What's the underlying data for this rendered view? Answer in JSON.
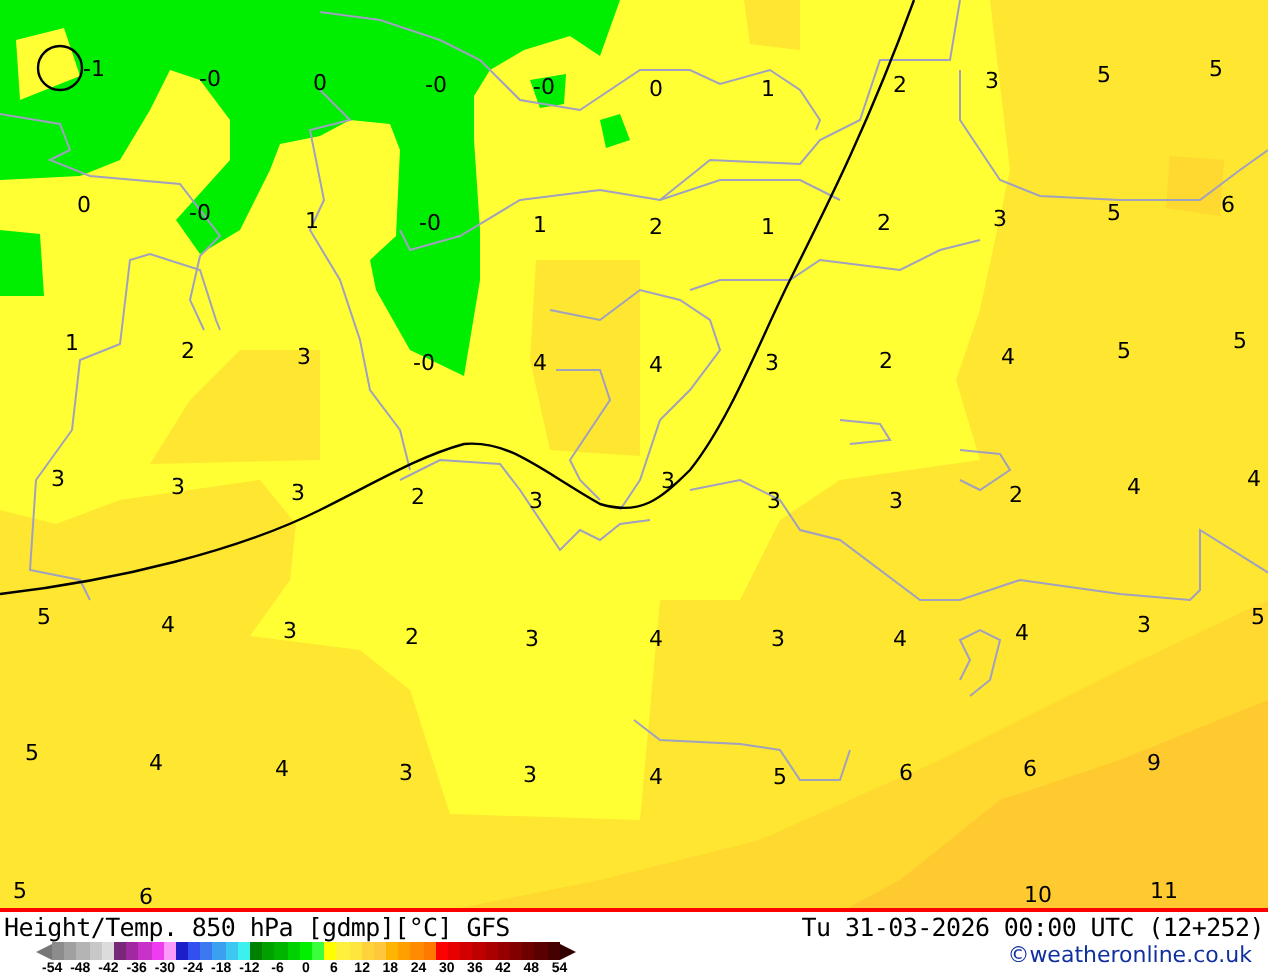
{
  "map": {
    "labels": [
      {
        "text": "-1"
      },
      {
        "text": "-0"
      },
      {
        "text": "0"
      },
      {
        "text": "-0"
      },
      {
        "text": "-0"
      },
      {
        "text": "0"
      },
      {
        "text": "1"
      },
      {
        "text": "2"
      },
      {
        "text": "3"
      },
      {
        "text": "5"
      },
      {
        "text": "5"
      },
      {
        "text": "0"
      },
      {
        "text": "-0"
      },
      {
        "text": "1"
      },
      {
        "text": "-0"
      },
      {
        "text": "1"
      },
      {
        "text": "2"
      },
      {
        "text": "1"
      },
      {
        "text": "2"
      },
      {
        "text": "3"
      },
      {
        "text": "5"
      },
      {
        "text": "6"
      },
      {
        "text": "1"
      },
      {
        "text": "2"
      },
      {
        "text": "3"
      },
      {
        "text": "-0"
      },
      {
        "text": "4"
      },
      {
        "text": "4"
      },
      {
        "text": "3"
      },
      {
        "text": "2"
      },
      {
        "text": "4"
      },
      {
        "text": "5"
      },
      {
        "text": "5"
      },
      {
        "text": "3"
      },
      {
        "text": "3"
      },
      {
        "text": "3"
      },
      {
        "text": "2"
      },
      {
        "text": "3"
      },
      {
        "text": "3"
      },
      {
        "text": "3"
      },
      {
        "text": "3"
      },
      {
        "text": "2"
      },
      {
        "text": "4"
      },
      {
        "text": "4"
      },
      {
        "text": "5"
      },
      {
        "text": "4"
      },
      {
        "text": "3"
      },
      {
        "text": "2"
      },
      {
        "text": "3"
      },
      {
        "text": "4"
      },
      {
        "text": "3"
      },
      {
        "text": "4"
      },
      {
        "text": "4"
      },
      {
        "text": "3"
      },
      {
        "text": "5"
      },
      {
        "text": "5"
      },
      {
        "text": "4"
      },
      {
        "text": "4"
      },
      {
        "text": "3"
      },
      {
        "text": "3"
      },
      {
        "text": "4"
      },
      {
        "text": "5"
      },
      {
        "text": "6"
      },
      {
        "text": "6"
      },
      {
        "text": "9"
      },
      {
        "text": "5"
      },
      {
        "text": "6"
      },
      {
        "text": "10"
      },
      {
        "text": "11"
      }
    ]
  },
  "footer": {
    "title": "Height/Temp. 850 hPa [gdmp][°C] GFS",
    "datetime": "Tu 31-03-2026 00:00 UTC (12+252)",
    "credit": "©weatheronline.co.uk",
    "colorbar": {
      "segments": [
        {
          "color": "#8c8c8c"
        },
        {
          "color": "#a0a0a0"
        },
        {
          "color": "#b4b4b4"
        },
        {
          "color": "#c8c8c8"
        },
        {
          "color": "#dcdcdc"
        },
        {
          "color": "#782878"
        },
        {
          "color": "#a028a0"
        },
        {
          "color": "#c832c8"
        },
        {
          "color": "#f03cf0"
        },
        {
          "color": "#fa9bfa"
        },
        {
          "color": "#1e1ec8"
        },
        {
          "color": "#3250f0"
        },
        {
          "color": "#3c78f0"
        },
        {
          "color": "#3ca0f0"
        },
        {
          "color": "#3cc8f0"
        },
        {
          "color": "#3cf0f0"
        },
        {
          "color": "#008200"
        },
        {
          "color": "#00a000"
        },
        {
          "color": "#00b400"
        },
        {
          "color": "#00d200"
        },
        {
          "color": "#00f000"
        },
        {
          "color": "#3cff3c"
        },
        {
          "color": "#ffff00"
        },
        {
          "color": "#fff03c"
        },
        {
          "color": "#ffe63c"
        },
        {
          "color": "#ffd23c"
        },
        {
          "color": "#ffc83c"
        },
        {
          "color": "#ffb400"
        },
        {
          "color": "#ffa000"
        },
        {
          "color": "#ff8c00"
        },
        {
          "color": "#ff7800"
        },
        {
          "color": "#ff0000"
        },
        {
          "color": "#e60000"
        },
        {
          "color": "#d20000"
        },
        {
          "color": "#be0000"
        },
        {
          "color": "#aa0000"
        },
        {
          "color": "#960000"
        },
        {
          "color": "#820000"
        },
        {
          "color": "#6e0000"
        },
        {
          "color": "#5a0000"
        },
        {
          "color": "#460000"
        }
      ],
      "ticks": [
        "-54",
        "-48",
        "-42",
        "-36",
        "-30",
        "-24",
        "-18",
        "-12",
        "-6",
        "0",
        "6",
        "12",
        "18",
        "24",
        "30",
        "36",
        "42",
        "48",
        "54"
      ]
    }
  }
}
